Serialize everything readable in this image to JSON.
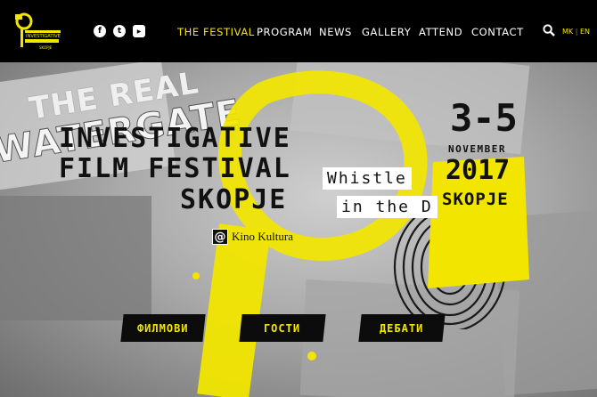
{
  "logo": {
    "line1": "INVESTIGATIVE",
    "line2": "SKOPJE"
  },
  "social": [
    {
      "icon": "facebook-icon",
      "glyph": "f"
    },
    {
      "icon": "twitter-icon",
      "glyph": "t"
    },
    {
      "icon": "youtube-icon",
      "glyph": "▶"
    }
  ],
  "nav": {
    "items": [
      "THE FESTIVAL",
      "PROGRAM",
      "NEWS",
      "GALLERY",
      "ATTEND",
      "CONTACT"
    ],
    "active": "THE FESTIVAL"
  },
  "lang": {
    "mk": "MK",
    "sep": "|",
    "en": "EN"
  },
  "hero": {
    "bg_title_1": "THE REAL",
    "bg_title_2": "WATERGATE",
    "title_1": "INVESTIGATIVE",
    "title_2": "FILM FESTIVAL",
    "title_3": "SKOPJE",
    "whistle_1": "Whistle",
    "whistle_2": "in the D",
    "venue_at": "@",
    "venue": "Kino Kultura",
    "date_range": "3-5",
    "month": "NOVEMBER",
    "year": "2017",
    "city": "SKOPJE"
  },
  "buttons": [
    "ФИЛМОВИ",
    "ГОСТИ",
    "ДЕБАТИ"
  ],
  "colors": {
    "accent": "#f2e600",
    "nav_bg": "#000000",
    "ink": "#111111"
  }
}
